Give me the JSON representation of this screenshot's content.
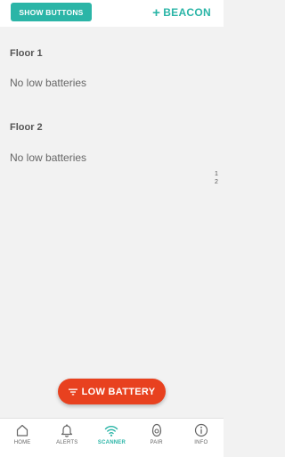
{
  "header": {
    "show_buttons_label": "SHOW BUTTONS",
    "beacon_label": "BEACON",
    "beacon_plus": "+"
  },
  "floors": [
    {
      "title": "Floor 1",
      "empty_text": "No low batteries"
    },
    {
      "title": "Floor 2",
      "empty_text": "No low batteries"
    }
  ],
  "page_index": [
    "1",
    "2"
  ],
  "fab": {
    "label": "LOW BATTERY",
    "icon": "filter-icon"
  },
  "nav": {
    "items": [
      {
        "label": "HOME",
        "icon": "home-icon"
      },
      {
        "label": "ALERTS",
        "icon": "bell-icon"
      },
      {
        "label": "SCANNER",
        "icon": "wifi-icon",
        "active": true
      },
      {
        "label": "PAIR",
        "icon": "pair-icon"
      },
      {
        "label": "INFO",
        "icon": "info-icon"
      }
    ]
  },
  "colors": {
    "accent": "#2bb5a7",
    "fab": "#e8411f",
    "background": "#f2f2f2"
  }
}
